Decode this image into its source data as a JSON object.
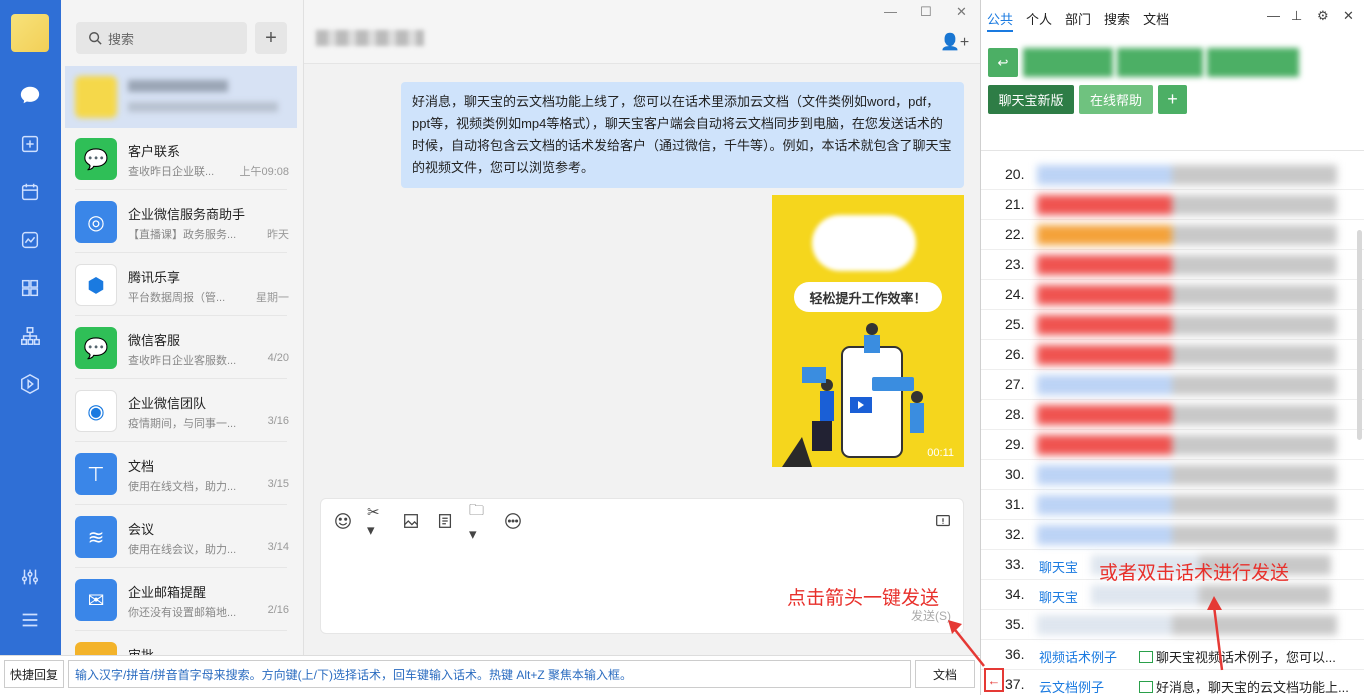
{
  "search": {
    "label": "搜索"
  },
  "conversations": [
    {
      "name": "客户联系",
      "preview": "查收昨日企业联...",
      "time": "上午09:08",
      "color": "#2fbf57",
      "icon": "chat-bubble-icon"
    },
    {
      "name": "企业微信服务商助手",
      "preview": "【直播课】政务服务...",
      "time": "昨天",
      "color": "#3a86e8",
      "icon": "helper-icon"
    },
    {
      "name": "腾讯乐享",
      "preview": "平台数据周报（管...",
      "time": "星期一",
      "color": "#ffffff",
      "icon": "hexagon-icon"
    },
    {
      "name": "微信客服",
      "preview": "查收昨日企业客服数...",
      "time": "4/20",
      "color": "#2fbf57",
      "icon": "service-icon"
    },
    {
      "name": "企业微信团队",
      "preview": "疫情期间，与同事一...",
      "time": "3/16",
      "color": "#ffffff",
      "icon": "wecom-icon"
    },
    {
      "name": "文档",
      "preview": "使用在线文档，助力...",
      "time": "3/15",
      "color": "#3a86e8",
      "icon": "document-icon"
    },
    {
      "name": "会议",
      "preview": "使用在线会议，助力...",
      "time": "3/14",
      "color": "#3a86e8",
      "icon": "meeting-icon"
    },
    {
      "name": "企业邮箱提醒",
      "preview": "你还没有设置邮箱地...",
      "time": "2/16",
      "color": "#3a86e8",
      "icon": "mail-icon"
    },
    {
      "name": "审批",
      "preview": "",
      "time": "",
      "color": "#f3b32a",
      "icon": "approval-icon"
    }
  ],
  "chat": {
    "message": "好消息，聊天宝的云文档功能上线了，您可以在话术里添加云文档（文件类例如word，pdf，ppt等，视频类例如mp4等格式），聊天宝客户端会自动将云文档同步到电脑，在您发送话术的时候，自动将包含云文档的话术发给客户（通过微信，千牛等）。例如，本话术就包含了聊天宝的视频文件，您可以浏览参考。",
    "video_caption": "轻松提升工作效率！",
    "video_duration": "00:11",
    "hint_click": "点击箭头一键发送",
    "send_label": "发送(S)"
  },
  "bottom": {
    "quick_reply": "快捷回复",
    "input_hint": "输入汉字/拼音/拼音首字母来搜索。方向键(上/下)选择话术，回车键输入话术。热键 Alt+Z 聚焦本输入框。",
    "doc_button": "文档"
  },
  "panel": {
    "tabs": [
      "公共",
      "个人",
      "部门",
      "搜索",
      "文档"
    ],
    "btn_new": "聊天宝新版",
    "btn_help": "在线帮助",
    "hint_double": "或者双击话术进行发送",
    "rows": [
      {
        "num": "20."
      },
      {
        "num": "21."
      },
      {
        "num": "22."
      },
      {
        "num": "23."
      },
      {
        "num": "24."
      },
      {
        "num": "25."
      },
      {
        "num": "26."
      },
      {
        "num": "27."
      },
      {
        "num": "28."
      },
      {
        "num": "29."
      },
      {
        "num": "30."
      },
      {
        "num": "31."
      },
      {
        "num": "32."
      },
      {
        "num": "33.",
        "link": "聊天宝"
      },
      {
        "num": "34.",
        "link": "聊天宝"
      },
      {
        "num": "35."
      },
      {
        "num": "36.",
        "link": "视频话术例子",
        "text": "聊天宝视频话术例子，您可以..."
      },
      {
        "num": "37.",
        "link": "云文档例子",
        "text": "好消息，聊天宝的云文档功能上..."
      }
    ]
  },
  "colors": {
    "accent": "#1a7ae0",
    "rail": "#2f6fd6",
    "green": "#4caf65",
    "red": "#e8302b"
  }
}
